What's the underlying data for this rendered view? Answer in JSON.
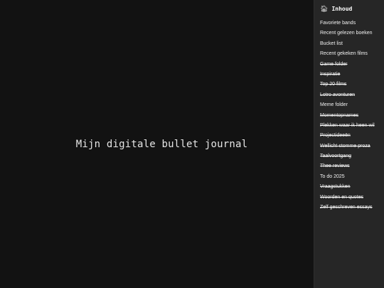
{
  "main": {
    "title": "Mijn digitale bullet journal"
  },
  "sidebar": {
    "title": "Inhoud",
    "home_icon": "home-icon",
    "items": [
      {
        "label": "Favoriete bands",
        "struck": false
      },
      {
        "label": "Recent gelezen boeken",
        "struck": false
      },
      {
        "label": "Bucket list",
        "struck": false
      },
      {
        "label": "Recent gekeken films",
        "struck": false
      },
      {
        "label": "Game folder",
        "struck": true
      },
      {
        "label": "Inspiratie",
        "struck": true
      },
      {
        "label": "Top 20 films",
        "struck": true
      },
      {
        "label": "Lotro avonturen",
        "struck": true
      },
      {
        "label": "Meme folder",
        "struck": false
      },
      {
        "label": "Momentopnames",
        "struck": true
      },
      {
        "label": "Plekken waar ik heen wil",
        "struck": true
      },
      {
        "label": "Projectideeën",
        "struck": true
      },
      {
        "label": "Wellicht stomme proza",
        "struck": true
      },
      {
        "label": "Taalvoortgang",
        "struck": true
      },
      {
        "label": "Thee reviews",
        "struck": true
      },
      {
        "label": "To do 2025",
        "struck": false
      },
      {
        "label": "Vraagstukken",
        "struck": true
      },
      {
        "label": "Woorden en quotes",
        "struck": true
      },
      {
        "label": "Zelf geschreven essays",
        "struck": true
      }
    ]
  },
  "colors": {
    "background": "#121212",
    "sidebar_background": "#262626",
    "text": "#f1f1f1"
  }
}
